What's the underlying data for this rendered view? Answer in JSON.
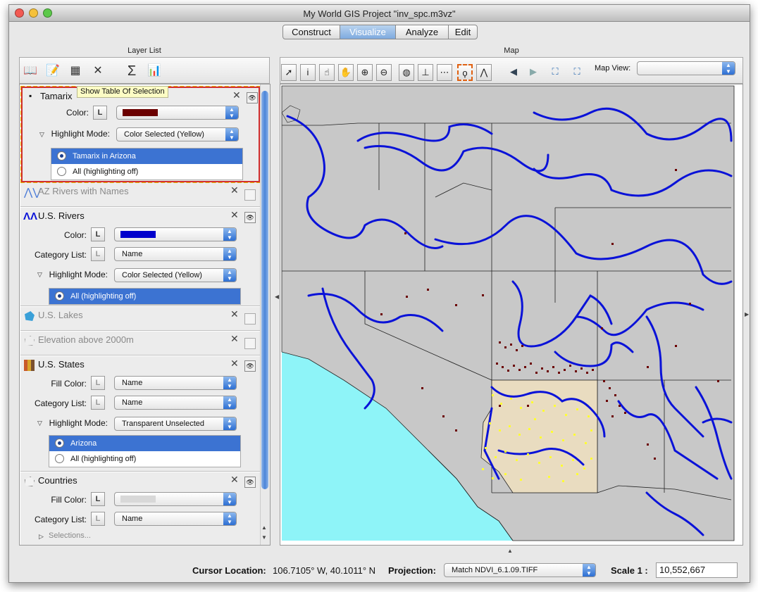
{
  "window": {
    "title": "My World GIS Project \"inv_spc.m3vz\""
  },
  "tabs": [
    {
      "label": "Construct"
    },
    {
      "label": "Visualize"
    },
    {
      "label": "Analyze"
    },
    {
      "label": "Edit"
    }
  ],
  "active_tab": "Visualize",
  "layer_list": {
    "header": "Layer List",
    "tooltip": "Show Table Of Selection",
    "layers": [
      {
        "name": "Tamarix",
        "color_label": "Color:",
        "color": "#6b0000",
        "highlight_label": "Highlight Mode:",
        "highlight_value": "Color Selected (Yellow)",
        "selections": [
          {
            "label": "Tamarix in Arizona",
            "selected": true
          },
          {
            "label": "All (highlighting off)",
            "selected": false
          }
        ]
      },
      {
        "name": "AZ Rivers with Names"
      },
      {
        "name": "U.S. Rivers",
        "color_label": "Color:",
        "color": "#0000cc",
        "category_label": "Category List:",
        "category_value": "Name",
        "highlight_label": "Highlight Mode:",
        "highlight_value": "Color Selected (Yellow)",
        "selections": [
          {
            "label": "All (highlighting off)",
            "selected": true
          }
        ]
      },
      {
        "name": "U.S. Lakes"
      },
      {
        "name": "Elevation above 2000m"
      },
      {
        "name": "U.S. States",
        "fill_label": "Fill Color:",
        "fill_value": "Name",
        "category_label": "Category List:",
        "category_value": "Name",
        "highlight_label": "Highlight Mode:",
        "highlight_value": "Transparent Unselected",
        "selections": [
          {
            "label": "Arizona",
            "selected": true
          },
          {
            "label": "All (highlighting off)",
            "selected": false
          }
        ]
      },
      {
        "name": "Countries",
        "fill_label": "Fill Color:",
        "fill_color": "#d8d8d8",
        "category_label": "Category List:",
        "category_value": "Name",
        "selections_link": "Selections..."
      }
    ]
  },
  "map": {
    "header": "Map",
    "map_view_label": "Map View:",
    "map_view_value": ""
  },
  "status": {
    "cursor_label": "Cursor Location:",
    "cursor_value": "106.7105° W, 40.1011° N",
    "projection_label": "Projection:",
    "projection_value": "Match NDVI_6.1.09.TIFF",
    "scale_label": "Scale 1 :",
    "scale_value": "10,552,667"
  },
  "colors": {
    "ocean": "#8ef4f8",
    "land": "#c8c8c8",
    "rivers": "#0a12d8",
    "points": "#6b0000",
    "selected_points": "#ffff33",
    "arizona": "#e9dcc0",
    "accent": "#3c73d2"
  },
  "icons": [
    "open-book-icon",
    "edit-notepad-icon",
    "table-icon",
    "delete-x-icon",
    "sigma-icon",
    "histogram-icon",
    "pointer-icon",
    "info-pointer-icon",
    "pan-hand-icon",
    "grab-hand-icon",
    "zoom-in-icon",
    "zoom-out-icon",
    "globe-icon",
    "measure-icon",
    "rect-select-icon",
    "lasso-icon",
    "profile-icon",
    "back-arrow-icon",
    "forward-arrow-icon",
    "zoom-extent-icon",
    "zoom-layer-icon"
  ]
}
